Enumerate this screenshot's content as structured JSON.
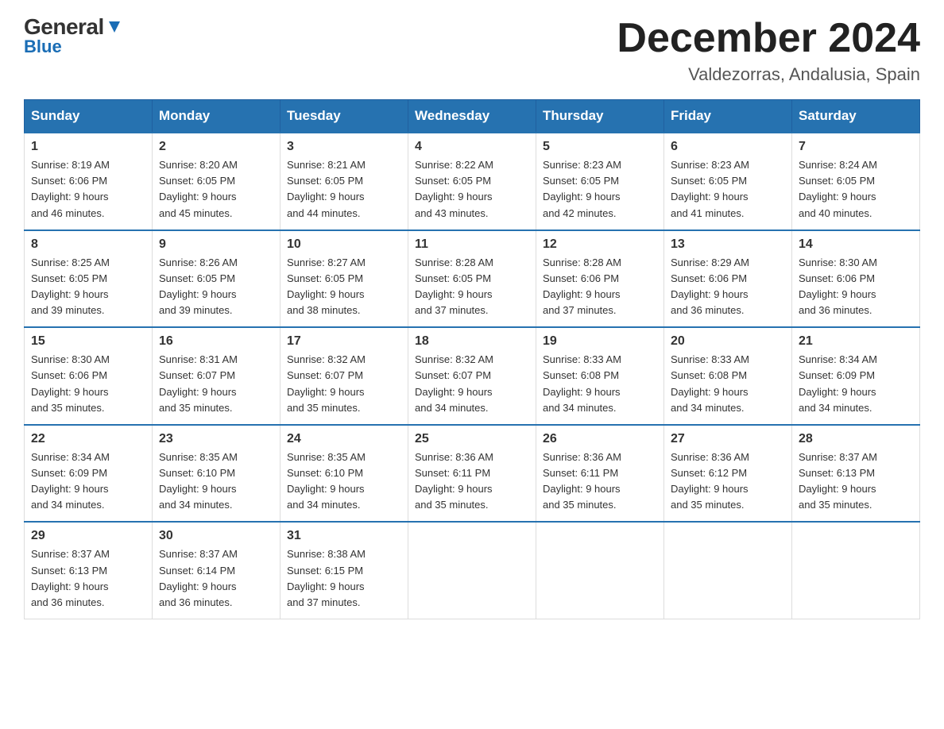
{
  "logo": {
    "general": "General",
    "blue": "Blue"
  },
  "title": "December 2024",
  "location": "Valdezorras, Andalusia, Spain",
  "weekdays": [
    "Sunday",
    "Monday",
    "Tuesday",
    "Wednesday",
    "Thursday",
    "Friday",
    "Saturday"
  ],
  "weeks": [
    [
      {
        "day": "1",
        "sunrise": "8:19 AM",
        "sunset": "6:06 PM",
        "daylight": "9 hours and 46 minutes."
      },
      {
        "day": "2",
        "sunrise": "8:20 AM",
        "sunset": "6:05 PM",
        "daylight": "9 hours and 45 minutes."
      },
      {
        "day": "3",
        "sunrise": "8:21 AM",
        "sunset": "6:05 PM",
        "daylight": "9 hours and 44 minutes."
      },
      {
        "day": "4",
        "sunrise": "8:22 AM",
        "sunset": "6:05 PM",
        "daylight": "9 hours and 43 minutes."
      },
      {
        "day": "5",
        "sunrise": "8:23 AM",
        "sunset": "6:05 PM",
        "daylight": "9 hours and 42 minutes."
      },
      {
        "day": "6",
        "sunrise": "8:23 AM",
        "sunset": "6:05 PM",
        "daylight": "9 hours and 41 minutes."
      },
      {
        "day": "7",
        "sunrise": "8:24 AM",
        "sunset": "6:05 PM",
        "daylight": "9 hours and 40 minutes."
      }
    ],
    [
      {
        "day": "8",
        "sunrise": "8:25 AM",
        "sunset": "6:05 PM",
        "daylight": "9 hours and 39 minutes."
      },
      {
        "day": "9",
        "sunrise": "8:26 AM",
        "sunset": "6:05 PM",
        "daylight": "9 hours and 39 minutes."
      },
      {
        "day": "10",
        "sunrise": "8:27 AM",
        "sunset": "6:05 PM",
        "daylight": "9 hours and 38 minutes."
      },
      {
        "day": "11",
        "sunrise": "8:28 AM",
        "sunset": "6:05 PM",
        "daylight": "9 hours and 37 minutes."
      },
      {
        "day": "12",
        "sunrise": "8:28 AM",
        "sunset": "6:06 PM",
        "daylight": "9 hours and 37 minutes."
      },
      {
        "day": "13",
        "sunrise": "8:29 AM",
        "sunset": "6:06 PM",
        "daylight": "9 hours and 36 minutes."
      },
      {
        "day": "14",
        "sunrise": "8:30 AM",
        "sunset": "6:06 PM",
        "daylight": "9 hours and 36 minutes."
      }
    ],
    [
      {
        "day": "15",
        "sunrise": "8:30 AM",
        "sunset": "6:06 PM",
        "daylight": "9 hours and 35 minutes."
      },
      {
        "day": "16",
        "sunrise": "8:31 AM",
        "sunset": "6:07 PM",
        "daylight": "9 hours and 35 minutes."
      },
      {
        "day": "17",
        "sunrise": "8:32 AM",
        "sunset": "6:07 PM",
        "daylight": "9 hours and 35 minutes."
      },
      {
        "day": "18",
        "sunrise": "8:32 AM",
        "sunset": "6:07 PM",
        "daylight": "9 hours and 34 minutes."
      },
      {
        "day": "19",
        "sunrise": "8:33 AM",
        "sunset": "6:08 PM",
        "daylight": "9 hours and 34 minutes."
      },
      {
        "day": "20",
        "sunrise": "8:33 AM",
        "sunset": "6:08 PM",
        "daylight": "9 hours and 34 minutes."
      },
      {
        "day": "21",
        "sunrise": "8:34 AM",
        "sunset": "6:09 PM",
        "daylight": "9 hours and 34 minutes."
      }
    ],
    [
      {
        "day": "22",
        "sunrise": "8:34 AM",
        "sunset": "6:09 PM",
        "daylight": "9 hours and 34 minutes."
      },
      {
        "day": "23",
        "sunrise": "8:35 AM",
        "sunset": "6:10 PM",
        "daylight": "9 hours and 34 minutes."
      },
      {
        "day": "24",
        "sunrise": "8:35 AM",
        "sunset": "6:10 PM",
        "daylight": "9 hours and 34 minutes."
      },
      {
        "day": "25",
        "sunrise": "8:36 AM",
        "sunset": "6:11 PM",
        "daylight": "9 hours and 35 minutes."
      },
      {
        "day": "26",
        "sunrise": "8:36 AM",
        "sunset": "6:11 PM",
        "daylight": "9 hours and 35 minutes."
      },
      {
        "day": "27",
        "sunrise": "8:36 AM",
        "sunset": "6:12 PM",
        "daylight": "9 hours and 35 minutes."
      },
      {
        "day": "28",
        "sunrise": "8:37 AM",
        "sunset": "6:13 PM",
        "daylight": "9 hours and 35 minutes."
      }
    ],
    [
      {
        "day": "29",
        "sunrise": "8:37 AM",
        "sunset": "6:13 PM",
        "daylight": "9 hours and 36 minutes."
      },
      {
        "day": "30",
        "sunrise": "8:37 AM",
        "sunset": "6:14 PM",
        "daylight": "9 hours and 36 minutes."
      },
      {
        "day": "31",
        "sunrise": "8:38 AM",
        "sunset": "6:15 PM",
        "daylight": "9 hours and 37 minutes."
      },
      null,
      null,
      null,
      null
    ]
  ],
  "labels": {
    "sunrise": "Sunrise:",
    "sunset": "Sunset:",
    "daylight": "Daylight:"
  }
}
